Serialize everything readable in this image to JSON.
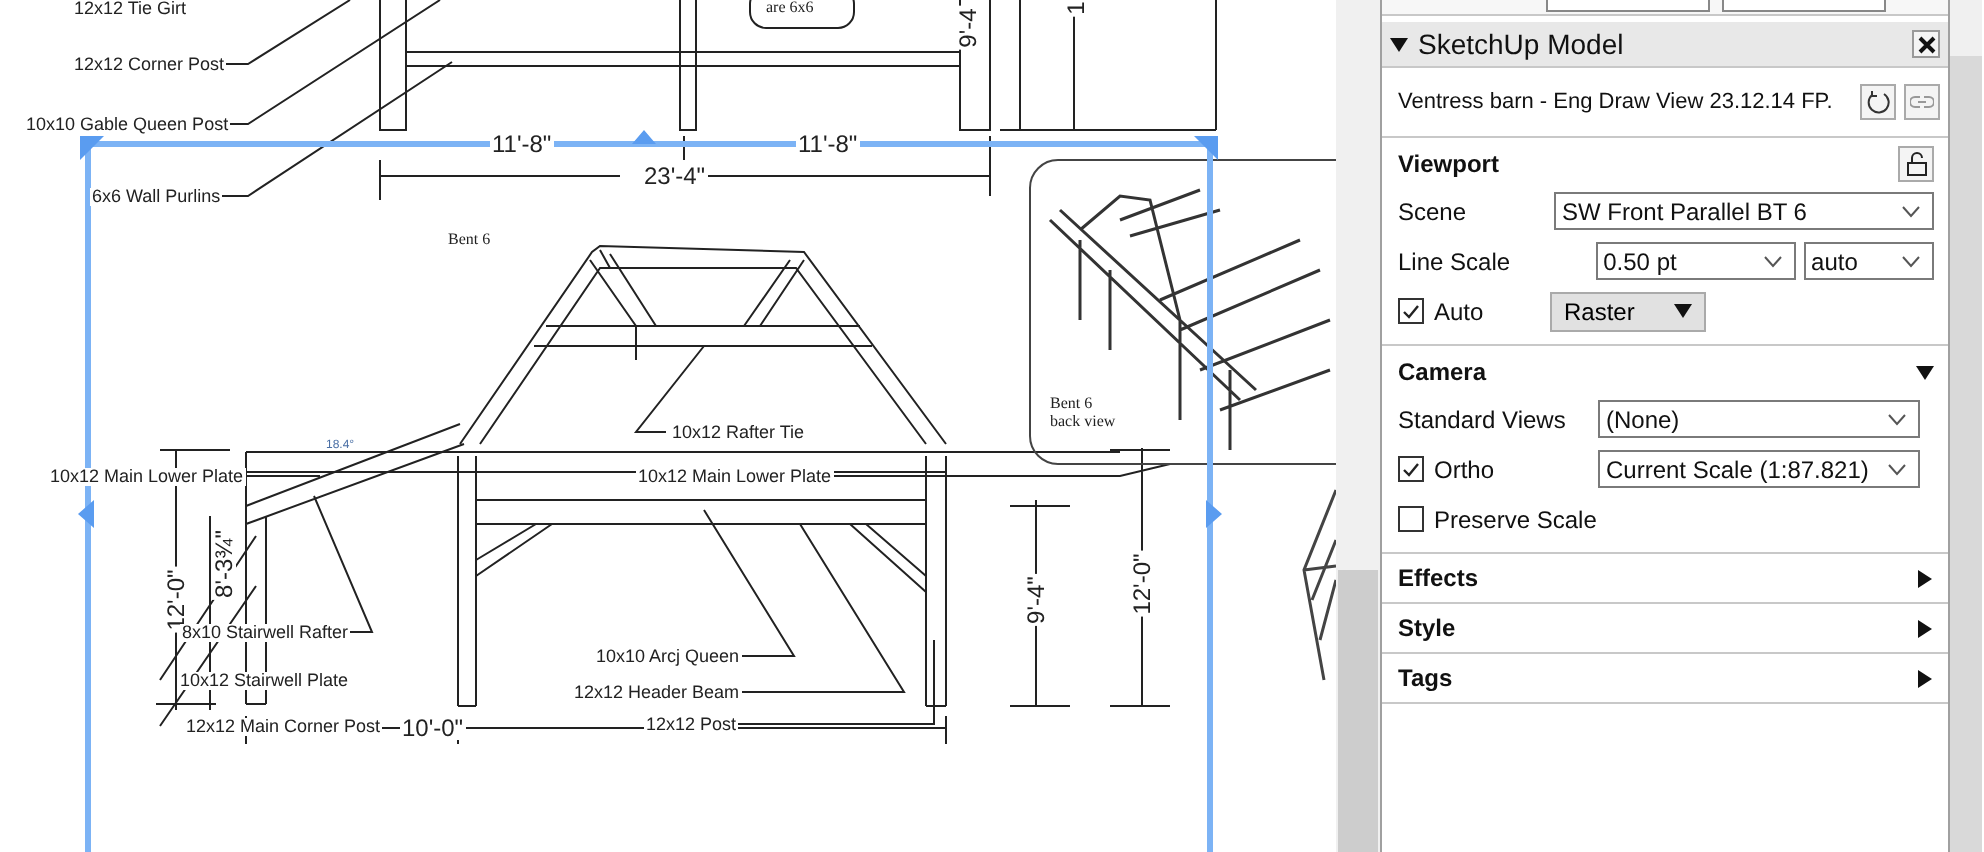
{
  "canvas": {
    "labels": [
      {
        "text": "12x12 Tie Girt",
        "kind": "callout"
      },
      {
        "text": "12x12 Corner Post",
        "kind": "callout"
      },
      {
        "text": "10x10 Gable Queen Post",
        "kind": "callout"
      },
      {
        "text": "6x6 Wall Purlins",
        "kind": "callout"
      },
      {
        "text": "are 6x6",
        "kind": "note"
      },
      {
        "text": "9'-4",
        "kind": "vertical"
      },
      {
        "text": "1",
        "kind": "vertical"
      },
      {
        "text": "11'-8\"",
        "kind": "dimension"
      },
      {
        "text": "11'-8\"",
        "kind": "dimension"
      },
      {
        "text": "23'-4\"",
        "kind": "dimension"
      },
      {
        "text": "Bent 6",
        "kind": "title"
      },
      {
        "text": "10x12 Rafter Tie",
        "kind": "callout"
      },
      {
        "text": "10x12 Main Lower Plate",
        "kind": "callout"
      },
      {
        "text": "10x12  Main  Lower Plate",
        "kind": "callout"
      },
      {
        "text": "18.4°",
        "kind": "angle"
      },
      {
        "text": "12'-0\"",
        "kind": "vertical"
      },
      {
        "text": "8'-3¾\"",
        "kind": "vertical"
      },
      {
        "text": "8x10 Stairwell Rafter",
        "kind": "callout"
      },
      {
        "text": "10x12 Stairwell Plate",
        "kind": "callout"
      },
      {
        "text": "12x12 Main Corner Post",
        "kind": "callout"
      },
      {
        "text": "10'-0\"",
        "kind": "dimension"
      },
      {
        "text": "10x10 Arcj Queen",
        "kind": "callout"
      },
      {
        "text": "12x12 Header Beam",
        "kind": "callout"
      },
      {
        "text": "12x12 Post",
        "kind": "callout"
      },
      {
        "text": "9'-4\"",
        "kind": "vertical"
      },
      {
        "text": "12'-0\"",
        "kind": "vertical"
      }
    ],
    "inset": {
      "caption": [
        "Bent 6",
        "back view"
      ]
    }
  },
  "panel": {
    "title": "SketchUp Model",
    "expanded": true,
    "file": "Ventress barn - Eng Draw View 23.12.14  FP.",
    "viewport": {
      "title": "Viewport",
      "scene_label": "Scene",
      "scene": "SW Front Parallel BT 6",
      "line_scale_label": "Line Scale",
      "line_scale": "0.50 pt",
      "line_scale_mode": "auto",
      "auto": {
        "label": "Auto",
        "checked": true
      },
      "render_mode": "Raster"
    },
    "camera": {
      "title": "Camera",
      "expanded": true,
      "standard_views_label": "Standard Views",
      "standard_view": "(None)",
      "ortho": {
        "label": "Ortho",
        "checked": true
      },
      "scale": "Current Scale (1:87.821)",
      "preserve_scale": {
        "label": "Preserve Scale",
        "checked": false
      }
    },
    "sections": [
      {
        "title": "Effects",
        "expanded": false
      },
      {
        "title": "Style",
        "expanded": false
      },
      {
        "title": "Tags",
        "expanded": false
      }
    ]
  }
}
